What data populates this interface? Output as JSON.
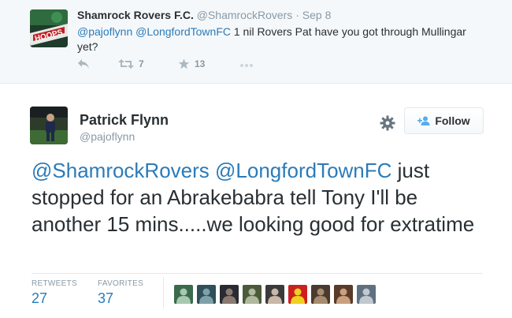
{
  "parent_tweet": {
    "author_name": "Shamrock Rovers F.C.",
    "author_handle": "@ShamrockRovers",
    "separator": "·",
    "date": "Sep 8",
    "mention_1": "@pajoflynn",
    "mention_2": "@LongfordTownFC",
    "text_rest": " 1 nil Rovers Pat have you got through Mullingar yet?",
    "avatar_text": "HOOPS",
    "retweet_count": "7",
    "favorite_count": "13"
  },
  "main_tweet": {
    "author_name": "Patrick Flynn",
    "author_handle": "@pajoflynn",
    "follow_label": "Follow",
    "mention_1": "@ShamrockRovers",
    "mention_2": "@LongfordTownFC",
    "text_rest": " just stopped for an Abrakebabra tell Tony I'll be another 15 mins.....we looking good for extratime",
    "retweets_label": "RETWEETS",
    "retweets_value": "27",
    "favorites_label": "FAVORITES",
    "favorites_value": "37"
  },
  "colors": {
    "link": "#2b7bb9",
    "muted": "#8899a6",
    "text": "#292f33",
    "border": "#e1e8ed"
  },
  "icons": {
    "reply": "reply-icon",
    "retweet": "retweet-icon",
    "favorite": "star-icon",
    "more": "more-icon",
    "gear": "gear-icon",
    "follow": "add-person-icon"
  },
  "favoriter_avatars": [
    {
      "name": "favoriter-avatar-1",
      "colors": [
        "#3a6b4a",
        "#a8c8b0"
      ]
    },
    {
      "name": "favoriter-avatar-2",
      "colors": [
        "#2f4f5a",
        "#7fa0a8"
      ]
    },
    {
      "name": "favoriter-avatar-3",
      "colors": [
        "#2a2a33",
        "#8a7a70"
      ]
    },
    {
      "name": "favoriter-avatar-4",
      "colors": [
        "#4a5a3a",
        "#b0b8a0"
      ]
    },
    {
      "name": "favoriter-avatar-5",
      "colors": [
        "#3a3a3a",
        "#c8b8a8"
      ]
    },
    {
      "name": "favoriter-avatar-6",
      "colors": [
        "#cc2020",
        "#f0d020"
      ]
    },
    {
      "name": "favoriter-avatar-7",
      "colors": [
        "#4a3a30",
        "#a88c70"
      ]
    },
    {
      "name": "favoriter-avatar-8",
      "colors": [
        "#5a3a28",
        "#c8a080"
      ]
    },
    {
      "name": "favoriter-avatar-9",
      "colors": [
        "#607080",
        "#c0c8d0"
      ]
    }
  ]
}
